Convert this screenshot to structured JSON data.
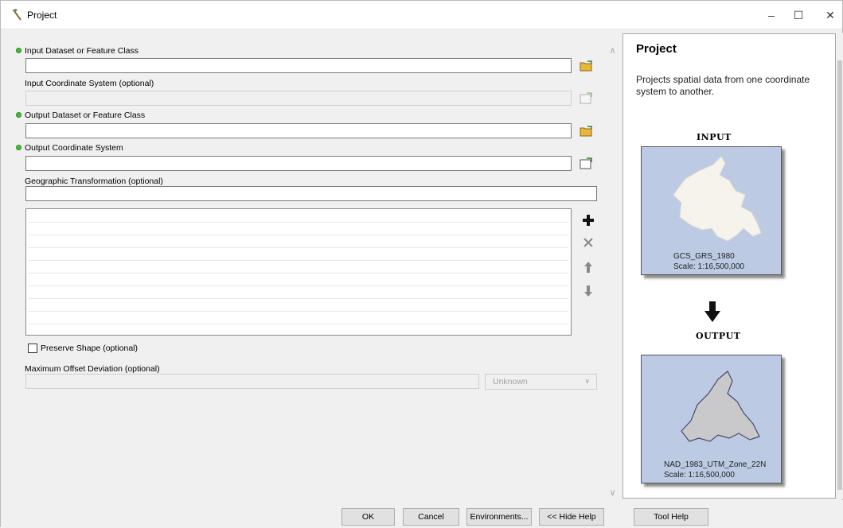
{
  "window": {
    "title": "Project",
    "icon": "hammer-icon",
    "controls": {
      "minimize": "–",
      "maximize": "☐",
      "close": "✕"
    }
  },
  "form": {
    "input_dataset": {
      "label": "Input Dataset or Feature Class",
      "value": "",
      "required": true
    },
    "input_cs": {
      "label": "Input Coordinate System (optional)",
      "value": "",
      "required": false
    },
    "output_dataset": {
      "label": "Output Dataset or Feature Class",
      "value": "",
      "required": true
    },
    "output_cs": {
      "label": "Output Coordinate System",
      "value": "",
      "required": true
    },
    "geo_transform": {
      "label": "Geographic Transformation (optional)",
      "value": "",
      "rows": [
        "",
        "",
        "",
        "",
        "",
        "",
        "",
        "",
        "",
        ""
      ]
    },
    "preserve_shape": {
      "label": "Preserve Shape (optional)",
      "checked": false
    },
    "max_offset": {
      "label": "Maximum Offset Deviation (optional)",
      "value": "",
      "unit": "Unknown"
    }
  },
  "help": {
    "title": "Project",
    "description": "Projects spatial data from one coordinate system to another.",
    "input_heading": "INPUT",
    "input_cs": "GCS_GRS_1980",
    "input_scale": "Scale: 1:16,500,000",
    "output_heading": "OUTPUT",
    "output_cs": "NAD_1983_UTM_Zone_22N",
    "output_scale": "Scale: 1:16,500,000"
  },
  "buttons": {
    "ok": "OK",
    "cancel": "Cancel",
    "environments": "Environments...",
    "hide_help": "<< Hide Help",
    "tool_help": "Tool Help"
  },
  "colors": {
    "required_dot": "#3fbf2f",
    "map_background": "#bccbe3",
    "folder_yellow": "#e8b83a"
  }
}
